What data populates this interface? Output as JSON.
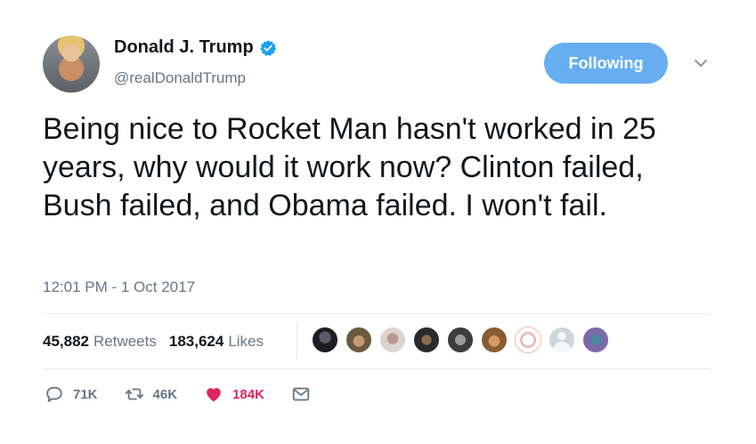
{
  "user": {
    "name": "Donald J. Trump",
    "handle": "@realDonaldTrump",
    "verified_color": "#1da1f2"
  },
  "follow_button": {
    "label": "Following",
    "color": "#66aef0"
  },
  "tweet": {
    "text": "Being nice to Rocket Man hasn't worked in 25 years, why would it work now? Clinton failed, Bush failed, and Obama failed. I won't fail.",
    "timestamp": "12:01 PM - 1 Oct 2017"
  },
  "stats": {
    "retweets_count": "45,882",
    "retweets_label": "Retweets",
    "likes_count": "183,624",
    "likes_label": "Likes"
  },
  "actions": {
    "reply_count": "71K",
    "retweet_count": "46K",
    "like_count": "184K",
    "like_color": "#e0245e"
  },
  "icons": [
    "verified-icon",
    "chevron-down-icon",
    "reply-icon",
    "retweet-icon",
    "heart-icon",
    "message-icon"
  ]
}
